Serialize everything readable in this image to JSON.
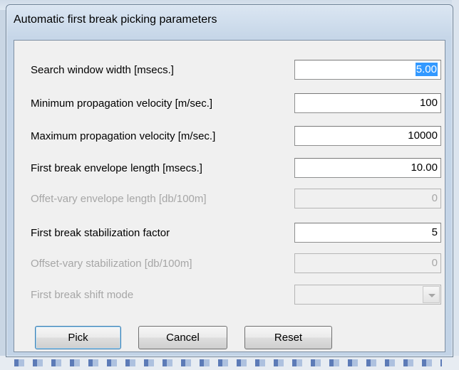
{
  "dialog": {
    "title": "Automatic first break picking parameters"
  },
  "fields": [
    {
      "label": "Search window width  [msecs.]",
      "value": "5.00",
      "enabled": true,
      "selected": true
    },
    {
      "label": "Minimum propagation velocity [m/sec.]",
      "value": "100",
      "enabled": true
    },
    {
      "label": "Maximum propagation velocity [m/sec.]",
      "value": "10000",
      "enabled": true
    },
    {
      "label": "First break envelope length [msecs.]",
      "value": "10.00",
      "enabled": true
    },
    {
      "label": "Offet-vary envelope length [db/100m]",
      "value": "0",
      "enabled": false
    },
    {
      "label": "First break stabilization factor",
      "value": "5",
      "enabled": true
    },
    {
      "label": "Offset-vary stabilization [db/100m]",
      "value": "0",
      "enabled": false
    },
    {
      "label": "First break shift mode",
      "value": "",
      "enabled": false
    }
  ],
  "buttons": {
    "pick": "Pick",
    "cancel": "Cancel",
    "reset": "Reset"
  }
}
